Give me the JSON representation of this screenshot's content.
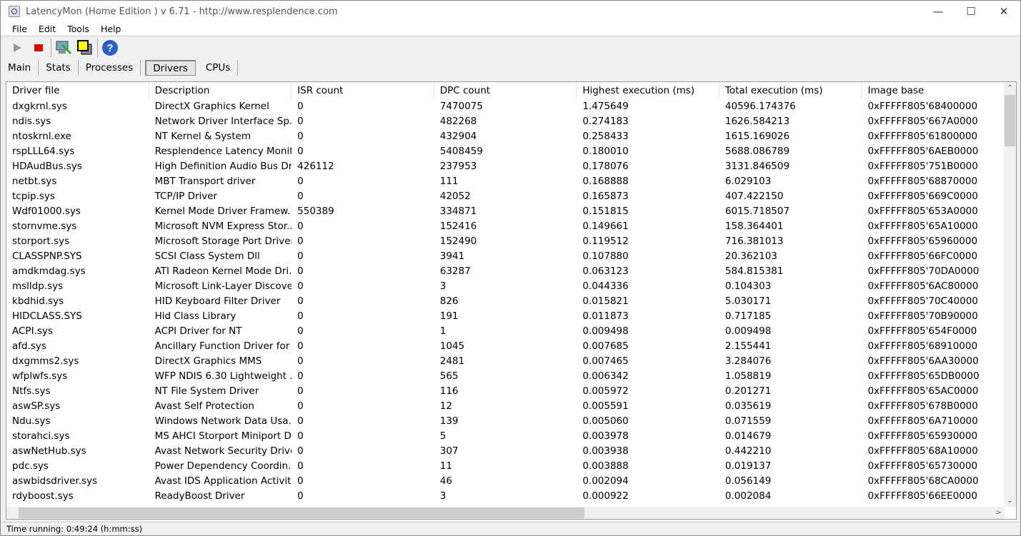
{
  "window": {
    "title": "LatencyMon  (Home Edition )  v 6.71 - http://www.resplendence.com",
    "minimize": "—",
    "maximize": "☐",
    "close": "✕"
  },
  "menu": [
    "File",
    "Edit",
    "Tools",
    "Help"
  ],
  "tabs": [
    "Main",
    "Stats",
    "Processes",
    "Drivers",
    "CPUs"
  ],
  "active_tab": "Drivers",
  "columns": [
    "Driver file",
    "Description",
    "ISR count",
    "DPC count",
    "Highest execution (ms)",
    "Total execution (ms)",
    "Image base"
  ],
  "rows": [
    [
      "dxgkrnl.sys",
      "DirectX Graphics Kernel",
      "0",
      "7470075",
      "1.475649",
      "40596.174376",
      "0xFFFFF805'68400000"
    ],
    [
      "ndis.sys",
      "Network Driver Interface Sp...",
      "0",
      "482268",
      "0.274183",
      "1626.584213",
      "0xFFFFF805'667A0000"
    ],
    [
      "ntoskrnl.exe",
      "NT Kernel & System",
      "0",
      "432904",
      "0.258433",
      "1615.169026",
      "0xFFFFF805'61800000"
    ],
    [
      "rspLLL64.sys",
      "Resplendence Latency Monit...",
      "0",
      "5408459",
      "0.180010",
      "5688.086789",
      "0xFFFFF805'6AEB0000"
    ],
    [
      "HDAudBus.sys",
      "High Definition Audio Bus Dri...",
      "426112",
      "237953",
      "0.178076",
      "3131.846509",
      "0xFFFFF805'751B0000"
    ],
    [
      "netbt.sys",
      "MBT Transport driver",
      "0",
      "111",
      "0.168888",
      "6.029103",
      "0xFFFFF805'68870000"
    ],
    [
      "tcpip.sys",
      "TCP/IP Driver",
      "0",
      "42052",
      "0.165873",
      "407.422150",
      "0xFFFFF805'669C0000"
    ],
    [
      "Wdf01000.sys",
      "Kernel Mode Driver Framew...",
      "550389",
      "334871",
      "0.151815",
      "6015.718507",
      "0xFFFFF805'653A0000"
    ],
    [
      "stornvme.sys",
      "Microsoft NVM Express Stor...",
      "0",
      "152416",
      "0.149661",
      "158.364401",
      "0xFFFFF805'65A10000"
    ],
    [
      "storport.sys",
      "Microsoft Storage Port Driver",
      "0",
      "152490",
      "0.119512",
      "716.381013",
      "0xFFFFF805'65960000"
    ],
    [
      "CLASSPNP.SYS",
      "SCSI Class System Dll",
      "0",
      "3941",
      "0.107880",
      "20.362103",
      "0xFFFFF805'66FC0000"
    ],
    [
      "amdkmdag.sys",
      "ATI Radeon Kernel Mode Dri...",
      "0",
      "63287",
      "0.063123",
      "584.815381",
      "0xFFFFF805'70DA0000"
    ],
    [
      "mslldp.sys",
      "Microsoft Link-Layer Discove...",
      "0",
      "3",
      "0.044336",
      "0.104303",
      "0xFFFFF805'6AC80000"
    ],
    [
      "kbdhid.sys",
      "HID Keyboard Filter Driver",
      "0",
      "826",
      "0.015821",
      "5.030171",
      "0xFFFFF805'70C40000"
    ],
    [
      "HIDCLASS.SYS",
      "Hid Class Library",
      "0",
      "191",
      "0.011873",
      "0.717185",
      "0xFFFFF805'70B90000"
    ],
    [
      "ACPI.sys",
      "ACPI Driver for NT",
      "0",
      "1",
      "0.009498",
      "0.009498",
      "0xFFFFF805'654F0000"
    ],
    [
      "afd.sys",
      "Ancillary Function Driver for ...",
      "0",
      "1045",
      "0.007685",
      "2.155441",
      "0xFFFFF805'68910000"
    ],
    [
      "dxgmms2.sys",
      "DirectX Graphics MMS",
      "0",
      "2481",
      "0.007465",
      "3.284076",
      "0xFFFFF805'6AA30000"
    ],
    [
      "wfplwfs.sys",
      "WFP NDIS 6.30 Lightweight ...",
      "0",
      "565",
      "0.006342",
      "1.058819",
      "0xFFFFF805'65DB0000"
    ],
    [
      "Ntfs.sys",
      "NT File System Driver",
      "0",
      "116",
      "0.005972",
      "0.201271",
      "0xFFFFF805'65AC0000"
    ],
    [
      "aswSP.sys",
      "Avast Self Protection",
      "0",
      "12",
      "0.005591",
      "0.035619",
      "0xFFFFF805'678B0000"
    ],
    [
      "Ndu.sys",
      "Windows Network Data Usa...",
      "0",
      "139",
      "0.005060",
      "0.071559",
      "0xFFFFF805'6A710000"
    ],
    [
      "storahci.sys",
      "MS AHCI Storport Miniport D...",
      "0",
      "5",
      "0.003978",
      "0.014679",
      "0xFFFFF805'65930000"
    ],
    [
      "aswNetHub.sys",
      "Avast Network Security Driver",
      "0",
      "307",
      "0.003938",
      "0.442210",
      "0xFFFFF805'68A10000"
    ],
    [
      "pdc.sys",
      "Power Dependency Coordin...",
      "0",
      "11",
      "0.003888",
      "0.019137",
      "0xFFFFF805'65730000"
    ],
    [
      "aswbidsdriver.sys",
      "Avast IDS Application Activit...",
      "0",
      "46",
      "0.002094",
      "0.056149",
      "0xFFFFF805'68CA0000"
    ],
    [
      "rdyboost.sys",
      "ReadyBoost Driver",
      "0",
      "3",
      "0.000922",
      "0.002084",
      "0xFFFFF805'66EE0000"
    ]
  ],
  "status": "Time running: 0:49:24  (h:mm:ss)",
  "colors": {
    "stop": "#e00000",
    "help": "#2a5fc4"
  }
}
